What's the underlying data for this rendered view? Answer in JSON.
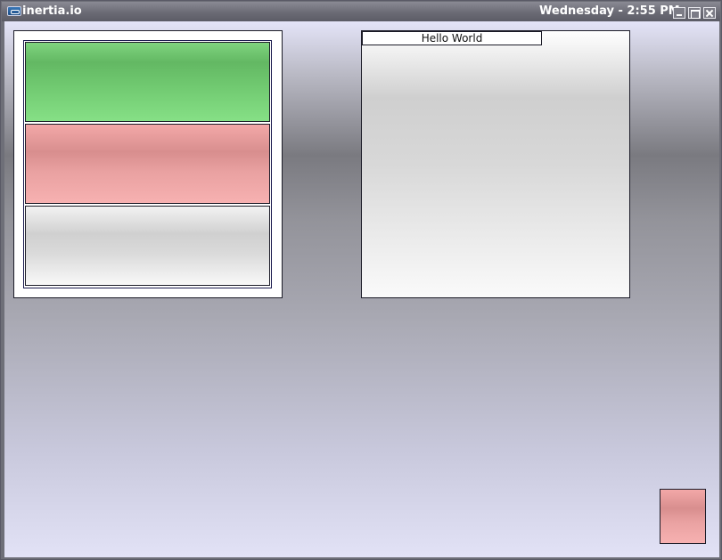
{
  "window": {
    "title": "inertia.io",
    "clock": "Wednesday - 2:55 PM",
    "icons": {
      "app": "app-icon",
      "minimize": "minimize-icon",
      "maximize": "maximize-icon",
      "close": "close-icon"
    }
  },
  "right_panel": {
    "label": "Hello World"
  },
  "left_panel": {
    "cells": [
      {
        "color": "#70c970"
      },
      {
        "color": "#e9a1a1"
      },
      {
        "color": "#dadada"
      }
    ]
  },
  "colors": {
    "titlebar": "#6b6b75",
    "desktop_top": "#e4e4f8",
    "desktop_mid": "#7a7a80",
    "accent_green": "#70c970",
    "accent_pink": "#e9a1a1"
  }
}
